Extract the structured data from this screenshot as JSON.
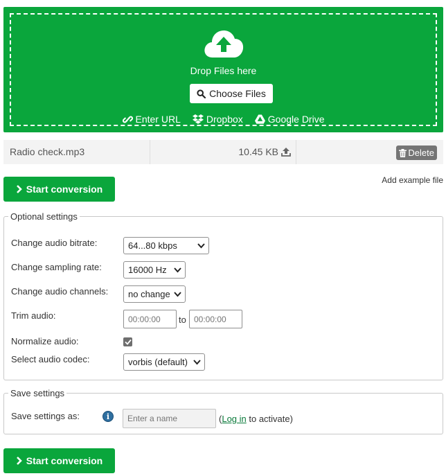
{
  "upload": {
    "drop_text": "Drop Files here",
    "choose_label": "Choose Files",
    "sources": [
      {
        "label": "Enter URL",
        "icon": "link-icon"
      },
      {
        "label": "Dropbox",
        "icon": "dropbox-icon"
      },
      {
        "label": "Google Drive",
        "icon": "google-drive-icon"
      }
    ],
    "accent_color": "#0aa63c"
  },
  "file": {
    "name": "Radio check.mp3",
    "size": "10.45 KB",
    "delete_label": "Delete"
  },
  "start_label": "Start conversion",
  "add_example_label": "Add example file",
  "optional": {
    "legend": "Optional settings",
    "bitrate_label": "Change audio bitrate:",
    "bitrate_value": "64...80 kbps",
    "sampling_label": "Change sampling rate:",
    "sampling_value": "16000 Hz",
    "channels_label": "Change audio channels:",
    "channels_value": "no change",
    "trim_label": "Trim audio:",
    "trim_start_placeholder": "00:00:00",
    "trim_to": "to",
    "trim_end_placeholder": "00:00:00",
    "normalize_label": "Normalize audio:",
    "normalize_checked": true,
    "codec_label": "Select audio codec:",
    "codec_value": "vorbis (default)"
  },
  "save": {
    "legend": "Save settings",
    "label": "Save settings as:",
    "name_placeholder": "Enter a name",
    "login_prefix": "(",
    "login_link": "Log in",
    "login_suffix": " to activate)"
  }
}
